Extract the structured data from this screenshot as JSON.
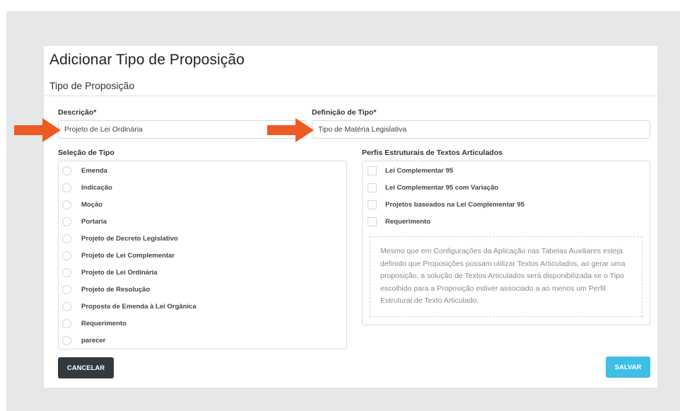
{
  "page": {
    "title": "Adicionar Tipo de Proposição",
    "section": "Tipo de Proposição"
  },
  "fields": {
    "descricao": {
      "label": "Descrição*",
      "value": "Projeto de Lei Ordinária"
    },
    "definicao": {
      "label": "Definição de Tipo*",
      "value": "Tipo de Matéria Legislativa"
    }
  },
  "selecao": {
    "label": "Seleção de Tipo",
    "items": [
      "Emenda",
      "Indicação",
      "Moção",
      "Portaria",
      "Projeto de Decreto Legislativo",
      "Projeto de Lei Complementar",
      "Projeto de Lei Ordinária",
      "Projeto de Resolução",
      "Proposta de Emenda à Lei Orgânica",
      "Requerimento",
      "parecer"
    ]
  },
  "perfis": {
    "label": "Perfis Estruturais de Textos Articulados",
    "items": [
      "Lei Complementar 95",
      "Lei Complementar 95 com Variação",
      "Projetos baseados na Lei Complementar 95",
      "Requerimento"
    ],
    "help": "Mesmo que em Configurações da Aplicação nas Tabelas Auxiliares esteja definido que Proposições possam utilizar Textos Articulados, ao gerar uma proposição, a solução de Textos Articulados será disponibilizada se o Tipo escolhido para a Proposição estiver associado a ao menos um Perfil Estrutural de Texto Articulado."
  },
  "actions": {
    "cancel": "CANCELAR",
    "save": "SALVAR"
  },
  "colors": {
    "arrow": "#ee5a24",
    "save_button": "#3dbfe6",
    "cancel_button": "#333a3f",
    "backdrop": "#e6e7e8"
  }
}
